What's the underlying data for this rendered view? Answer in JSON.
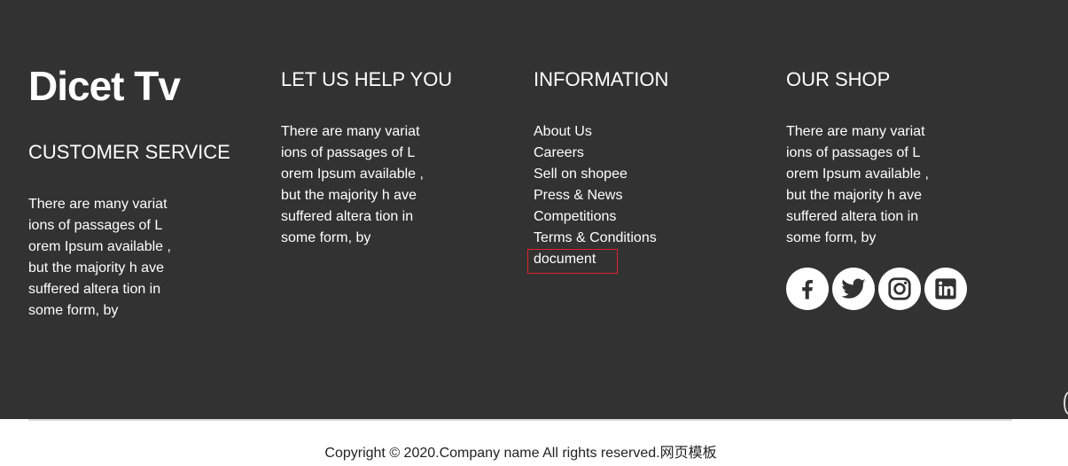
{
  "brand": "Dicet Tv",
  "customer_service": {
    "title": "CUSTOMER SERVICE",
    "lines": [
      "There are many variat",
      "ions of passages of L",
      "orem Ipsum available ,",
      "but the majority h ave",
      "suffered altera tion in",
      "some form, by"
    ]
  },
  "help": {
    "title": "LET US HELP YOU",
    "lines": [
      "There are many variat",
      "ions of passages of L",
      "orem Ipsum available ,",
      "but the majority h ave",
      "suffered altera tion in",
      "some form, by"
    ]
  },
  "information": {
    "title": "INFORMATION",
    "links": [
      "About Us",
      "Careers",
      "Sell on shopee",
      "Press & News",
      "Competitions",
      "Terms & Conditions",
      "document"
    ]
  },
  "shop": {
    "title": "OUR SHOP",
    "lines": [
      "There are many variat",
      "ions of passages of L",
      "orem Ipsum available ,",
      "but the majority h ave",
      "suffered altera tion in",
      "some form, by"
    ],
    "social": [
      "facebook-icon",
      "twitter-icon",
      "instagram-icon",
      "linkedin-icon"
    ]
  },
  "copyright": "Copyright © 2020.Company name All rights reserved.网页模板",
  "colors": {
    "footer_bg": "#323232",
    "highlight": "#e0242b"
  }
}
